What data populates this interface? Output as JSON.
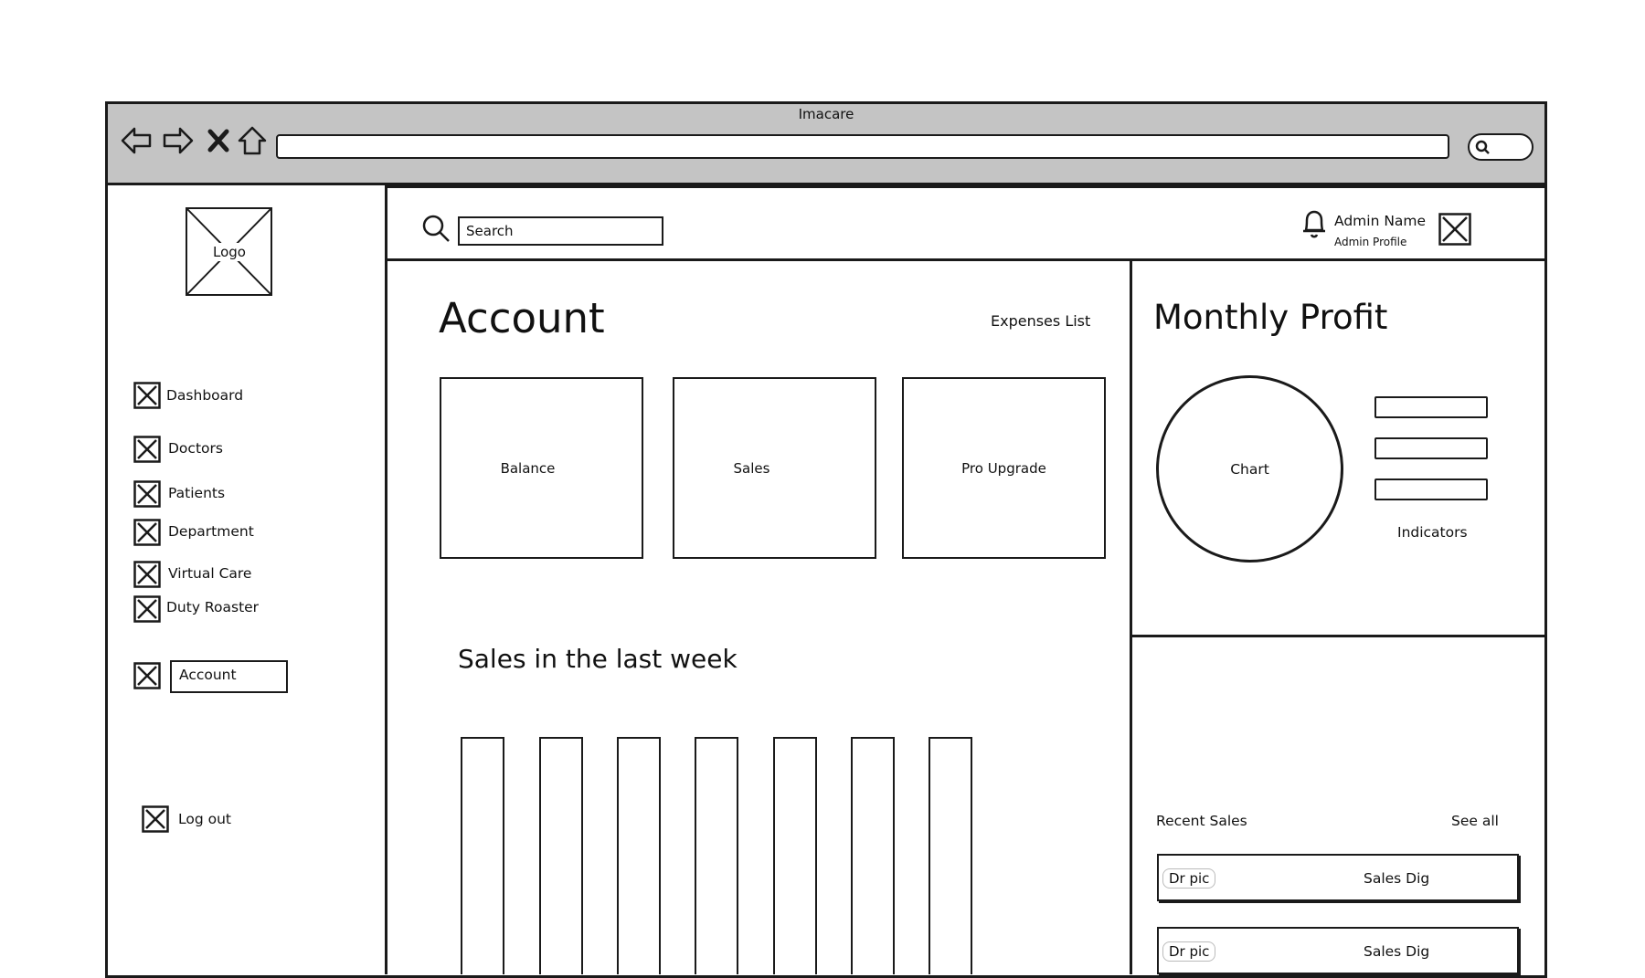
{
  "browser": {
    "title": "Imacare",
    "icons": [
      "back-arrow-icon",
      "forward-arrow-icon",
      "close-icon",
      "home-icon",
      "search-icon"
    ]
  },
  "sidebar": {
    "logo_label": "Logo",
    "items": [
      {
        "label": "Dashboard"
      },
      {
        "label": "Doctors"
      },
      {
        "label": "Patients"
      },
      {
        "label": "Department"
      },
      {
        "label": "Virtual Care"
      },
      {
        "label": "Duty Roaster"
      },
      {
        "label": "Account"
      }
    ],
    "logout_label": "Log out"
  },
  "header": {
    "search_placeholder": "Search",
    "admin_name": "Admin Name",
    "admin_profile": "Admin Profile"
  },
  "account": {
    "title": "Account",
    "expenses_link": "Expenses List",
    "cards": [
      {
        "label": "Balance"
      },
      {
        "label": "Sales"
      },
      {
        "label": "Pro Upgrade"
      }
    ]
  },
  "sales_week": {
    "title": "Sales in the last week",
    "bar_count": 7
  },
  "monthly_profit": {
    "title": "Monthly Profit",
    "chart_label": "Chart",
    "indicators_label": "Indicators"
  },
  "recent_sales": {
    "title": "Recent Sales",
    "see_all": "See all",
    "items": [
      {
        "pic": "Dr pic",
        "label": "Sales Dig"
      },
      {
        "pic": "Dr pic",
        "label": "Sales Dig"
      }
    ]
  }
}
